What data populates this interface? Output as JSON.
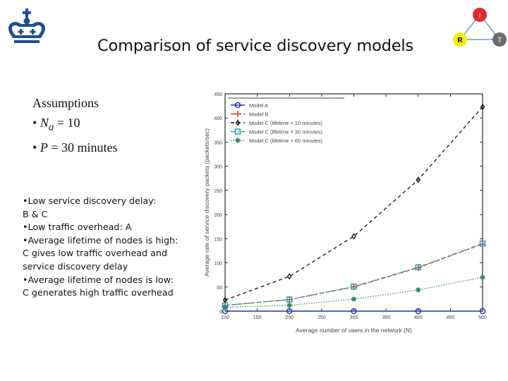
{
  "slide": {
    "title": "Comparison of service discovery models",
    "logo_icon": "crown-icon",
    "network_icon": {
      "name": "irt-triangle-icon",
      "nodes": [
        {
          "label": "I",
          "color": "#e02a2a"
        },
        {
          "label": "R",
          "color": "#f2ee10"
        },
        {
          "label": "T",
          "color": "#6b6b6b"
        }
      ],
      "edge_color": "#5b7fb3"
    },
    "assumptions": {
      "heading": "Assumptions",
      "items": [
        {
          "symbol": "N",
          "subscript": "a",
          "rest": " = 10"
        },
        {
          "symbol": "P",
          "subscript": "",
          "rest": " = 30 minutes"
        }
      ],
      "bullet": "•"
    },
    "bullets": [
      "•Low service discovery delay:",
      "B & C",
      "•Low traffic overhead: A",
      "•Average lifetime of nodes is high:",
      "C gives low traffic overhead and",
      "service discovery delay",
      "•Average lifetime of nodes is low:",
      "C generates high traffic overhead"
    ]
  },
  "chart_data": {
    "type": "line",
    "title": "",
    "xlabel": "Average number of users in the network (N)",
    "ylabel": "Average rate of service discovery packets (packets/sec)",
    "x": [
      100,
      200,
      300,
      400,
      500
    ],
    "xlim": [
      100,
      500
    ],
    "ylim": [
      0,
      450
    ],
    "xticks": [
      100,
      150,
      200,
      250,
      300,
      350,
      400,
      450,
      500
    ],
    "yticks": [
      0,
      50,
      100,
      150,
      200,
      250,
      300,
      350,
      400,
      450
    ],
    "grid": false,
    "legend_position": "top-left",
    "series": [
      {
        "name": "Model A",
        "values": [
          0,
          0,
          0,
          0,
          0
        ],
        "color": "#2233aa",
        "dash": "",
        "marker": "circle"
      },
      {
        "name": "Model B",
        "values": [
          12,
          24,
          50,
          90,
          139
        ],
        "color": "#d63b2a",
        "dash": "6,3",
        "marker": "plus"
      },
      {
        "name": "Model C (lifetime = 10 minutes)",
        "values": [
          23,
          72,
          155,
          272,
          423
        ],
        "color": "#111111",
        "dash": "5,4",
        "marker": "diamond"
      },
      {
        "name": "Model C (lifetime = 30 minutes)",
        "values": [
          12,
          24,
          51,
          91,
          140
        ],
        "color": "#2a9ab0",
        "dash": "7,3,2,3",
        "marker": "square"
      },
      {
        "name": "Model C (lifetime = 60 minutes)",
        "values": [
          8,
          12,
          25,
          44,
          70
        ],
        "color": "#3a8a6a",
        "dash": "1.5,2",
        "marker": "star"
      }
    ]
  }
}
